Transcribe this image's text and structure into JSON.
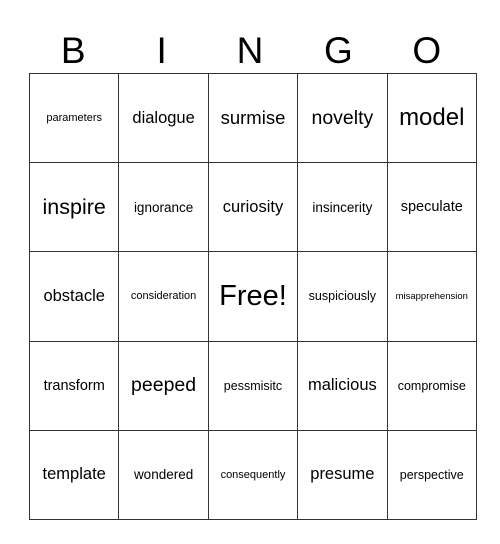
{
  "header": {
    "letters": [
      "B",
      "I",
      "N",
      "G",
      "O"
    ]
  },
  "grid": {
    "rows": [
      [
        "parameters",
        "dialogue",
        "surmise",
        "novelty",
        "model"
      ],
      [
        "inspire",
        "ignorance",
        "curiosity",
        "insincerity",
        "speculate"
      ],
      [
        "obstacle",
        "consideration",
        "Free!",
        "suspiciously",
        "misapprehension"
      ],
      [
        "transform",
        "peeped",
        "pessmisitc",
        "malicious",
        "compromise"
      ],
      [
        "template",
        "wondered",
        "consequently",
        "presume",
        "perspective"
      ]
    ]
  }
}
